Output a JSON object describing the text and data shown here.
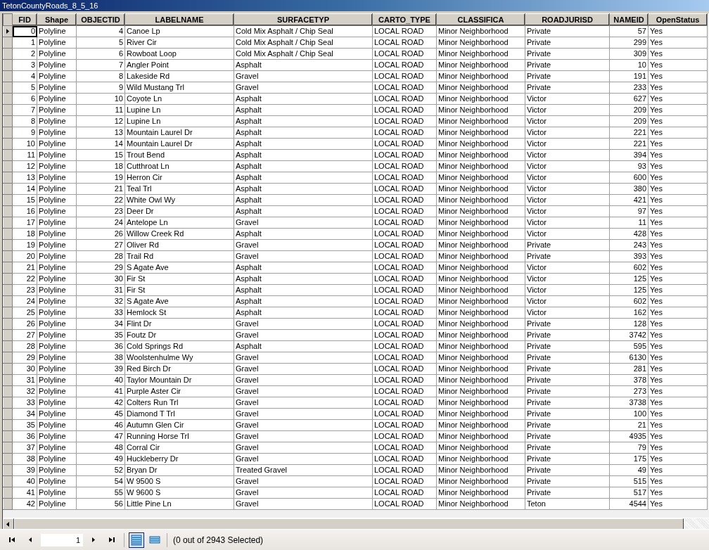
{
  "window": {
    "title": "TetonCountyRoads_8_5_16"
  },
  "table": {
    "columns": [
      {
        "label": "FID",
        "kind": "number"
      },
      {
        "label": "Shape",
        "kind": "text"
      },
      {
        "label": "OBJECTID",
        "kind": "number"
      },
      {
        "label": "LABELNAME",
        "kind": "text"
      },
      {
        "label": "SURFACETYP",
        "kind": "text"
      },
      {
        "label": "CARTO_TYPE",
        "kind": "text"
      },
      {
        "label": "CLASSIFICA",
        "kind": "text"
      },
      {
        "label": "ROADJURISD",
        "kind": "text"
      },
      {
        "label": "NAMEID",
        "kind": "number"
      },
      {
        "label": "OpenStatus",
        "kind": "text"
      }
    ],
    "rows": [
      {
        "current": true,
        "cells": [
          "0",
          "Polyline",
          "4",
          "Canoe Lp",
          "Cold Mix Asphalt / Chip Seal",
          "LOCAL ROAD",
          "Minor Neighborhood",
          "Private",
          "57",
          "Yes"
        ]
      },
      {
        "current": false,
        "cells": [
          "1",
          "Polyline",
          "5",
          "River Cir",
          "Cold Mix Asphalt / Chip Seal",
          "LOCAL ROAD",
          "Minor Neighborhood",
          "Private",
          "299",
          "Yes"
        ]
      },
      {
        "current": false,
        "cells": [
          "2",
          "Polyline",
          "6",
          "Rowboat Loop",
          "Cold Mix Asphalt / Chip Seal",
          "LOCAL ROAD",
          "Minor Neighborhood",
          "Private",
          "309",
          "Yes"
        ]
      },
      {
        "current": false,
        "cells": [
          "3",
          "Polyline",
          "7",
          "Angler Point",
          "Asphalt",
          "LOCAL ROAD",
          "Minor Neighborhood",
          "Private",
          "10",
          "Yes"
        ]
      },
      {
        "current": false,
        "cells": [
          "4",
          "Polyline",
          "8",
          "Lakeside Rd",
          "Gravel",
          "LOCAL ROAD",
          "Minor Neighborhood",
          "Private",
          "191",
          "Yes"
        ]
      },
      {
        "current": false,
        "cells": [
          "5",
          "Polyline",
          "9",
          "Wild Mustang Trl",
          "Gravel",
          "LOCAL ROAD",
          "Minor Neighborhood",
          "Private",
          "233",
          "Yes"
        ]
      },
      {
        "current": false,
        "cells": [
          "6",
          "Polyline",
          "10",
          "Coyote Ln",
          "Asphalt",
          "LOCAL ROAD",
          "Minor Neighborhood",
          "Victor",
          "627",
          "Yes"
        ]
      },
      {
        "current": false,
        "cells": [
          "7",
          "Polyline",
          "11",
          "Lupine Ln",
          "Asphalt",
          "LOCAL ROAD",
          "Minor Neighborhood",
          "Victor",
          "209",
          "Yes"
        ]
      },
      {
        "current": false,
        "cells": [
          "8",
          "Polyline",
          "12",
          "Lupine Ln",
          "Asphalt",
          "LOCAL ROAD",
          "Minor Neighborhood",
          "Victor",
          "209",
          "Yes"
        ]
      },
      {
        "current": false,
        "cells": [
          "9",
          "Polyline",
          "13",
          "Mountain Laurel Dr",
          "Asphalt",
          "LOCAL ROAD",
          "Minor Neighborhood",
          "Victor",
          "221",
          "Yes"
        ]
      },
      {
        "current": false,
        "cells": [
          "10",
          "Polyline",
          "14",
          "Mountain Laurel Dr",
          "Asphalt",
          "LOCAL ROAD",
          "Minor Neighborhood",
          "Victor",
          "221",
          "Yes"
        ]
      },
      {
        "current": false,
        "cells": [
          "11",
          "Polyline",
          "15",
          "Trout Bend",
          "Asphalt",
          "LOCAL ROAD",
          "Minor Neighborhood",
          "Victor",
          "394",
          "Yes"
        ]
      },
      {
        "current": false,
        "cells": [
          "12",
          "Polyline",
          "18",
          "Cutthroat Ln",
          "Asphalt",
          "LOCAL ROAD",
          "Minor Neighborhood",
          "Victor",
          "93",
          "Yes"
        ]
      },
      {
        "current": false,
        "cells": [
          "13",
          "Polyline",
          "19",
          "Herron Cir",
          "Asphalt",
          "LOCAL ROAD",
          "Minor Neighborhood",
          "Victor",
          "600",
          "Yes"
        ]
      },
      {
        "current": false,
        "cells": [
          "14",
          "Polyline",
          "21",
          "Teal Trl",
          "Asphalt",
          "LOCAL ROAD",
          "Minor Neighborhood",
          "Victor",
          "380",
          "Yes"
        ]
      },
      {
        "current": false,
        "cells": [
          "15",
          "Polyline",
          "22",
          "White Owl Wy",
          "Asphalt",
          "LOCAL ROAD",
          "Minor Neighborhood",
          "Victor",
          "421",
          "Yes"
        ]
      },
      {
        "current": false,
        "cells": [
          "16",
          "Polyline",
          "23",
          "Deer Dr",
          "Asphalt",
          "LOCAL ROAD",
          "Minor Neighborhood",
          "Victor",
          "97",
          "Yes"
        ]
      },
      {
        "current": false,
        "cells": [
          "17",
          "Polyline",
          "24",
          "Antelope Ln",
          "Gravel",
          "LOCAL ROAD",
          "Minor Neighborhood",
          "Victor",
          "11",
          "Yes"
        ]
      },
      {
        "current": false,
        "cells": [
          "18",
          "Polyline",
          "26",
          "Willow Creek Rd",
          "Asphalt",
          "LOCAL ROAD",
          "Minor Neighborhood",
          "Victor",
          "428",
          "Yes"
        ]
      },
      {
        "current": false,
        "cells": [
          "19",
          "Polyline",
          "27",
          "Oliver Rd",
          "Gravel",
          "LOCAL ROAD",
          "Minor Neighborhood",
          "Private",
          "243",
          "Yes"
        ]
      },
      {
        "current": false,
        "cells": [
          "20",
          "Polyline",
          "28",
          "Trail Rd",
          "Gravel",
          "LOCAL ROAD",
          "Minor Neighborhood",
          "Private",
          "393",
          "Yes"
        ]
      },
      {
        "current": false,
        "cells": [
          "21",
          "Polyline",
          "29",
          "S Agate Ave",
          "Asphalt",
          "LOCAL ROAD",
          "Minor Neighborhood",
          "Victor",
          "602",
          "Yes"
        ]
      },
      {
        "current": false,
        "cells": [
          "22",
          "Polyline",
          "30",
          "Fir St",
          "Asphalt",
          "LOCAL ROAD",
          "Minor Neighborhood",
          "Victor",
          "125",
          "Yes"
        ]
      },
      {
        "current": false,
        "cells": [
          "23",
          "Polyline",
          "31",
          "Fir St",
          "Asphalt",
          "LOCAL ROAD",
          "Minor Neighborhood",
          "Victor",
          "125",
          "Yes"
        ]
      },
      {
        "current": false,
        "cells": [
          "24",
          "Polyline",
          "32",
          "S Agate Ave",
          "Asphalt",
          "LOCAL ROAD",
          "Minor Neighborhood",
          "Victor",
          "602",
          "Yes"
        ]
      },
      {
        "current": false,
        "cells": [
          "25",
          "Polyline",
          "33",
          "Hemlock St",
          "Asphalt",
          "LOCAL ROAD",
          "Minor Neighborhood",
          "Victor",
          "162",
          "Yes"
        ]
      },
      {
        "current": false,
        "cells": [
          "26",
          "Polyline",
          "34",
          "Flint Dr",
          "Gravel",
          "LOCAL ROAD",
          "Minor Neighborhood",
          "Private",
          "128",
          "Yes"
        ]
      },
      {
        "current": false,
        "cells": [
          "27",
          "Polyline",
          "35",
          "Foutz Dr",
          "Gravel",
          "LOCAL ROAD",
          "Minor Neighborhood",
          "Private",
          "3742",
          "Yes"
        ]
      },
      {
        "current": false,
        "cells": [
          "28",
          "Polyline",
          "36",
          "Cold Springs Rd",
          "Asphalt",
          "LOCAL ROAD",
          "Minor Neighborhood",
          "Private",
          "595",
          "Yes"
        ]
      },
      {
        "current": false,
        "cells": [
          "29",
          "Polyline",
          "38",
          "Woolstenhulme Wy",
          "Gravel",
          "LOCAL ROAD",
          "Minor Neighborhood",
          "Private",
          "6130",
          "Yes"
        ]
      },
      {
        "current": false,
        "cells": [
          "30",
          "Polyline",
          "39",
          "Red Birch Dr",
          "Gravel",
          "LOCAL ROAD",
          "Minor Neighborhood",
          "Private",
          "281",
          "Yes"
        ]
      },
      {
        "current": false,
        "cells": [
          "31",
          "Polyline",
          "40",
          "Taylor Mountain Dr",
          "Gravel",
          "LOCAL ROAD",
          "Minor Neighborhood",
          "Private",
          "378",
          "Yes"
        ]
      },
      {
        "current": false,
        "cells": [
          "32",
          "Polyline",
          "41",
          "Purple Aster Cir",
          "Gravel",
          "LOCAL ROAD",
          "Minor Neighborhood",
          "Private",
          "273",
          "Yes"
        ]
      },
      {
        "current": false,
        "cells": [
          "33",
          "Polyline",
          "42",
          "Colters Run Trl",
          "Gravel",
          "LOCAL ROAD",
          "Minor Neighborhood",
          "Private",
          "3738",
          "Yes"
        ]
      },
      {
        "current": false,
        "cells": [
          "34",
          "Polyline",
          "45",
          "Diamond T Trl",
          "Gravel",
          "LOCAL ROAD",
          "Minor Neighborhood",
          "Private",
          "100",
          "Yes"
        ]
      },
      {
        "current": false,
        "cells": [
          "35",
          "Polyline",
          "46",
          "Autumn Glen Cir",
          "Gravel",
          "LOCAL ROAD",
          "Minor Neighborhood",
          "Private",
          "21",
          "Yes"
        ]
      },
      {
        "current": false,
        "cells": [
          "36",
          "Polyline",
          "47",
          "Running Horse Trl",
          "Gravel",
          "LOCAL ROAD",
          "Minor Neighborhood",
          "Private",
          "4935",
          "Yes"
        ]
      },
      {
        "current": false,
        "cells": [
          "37",
          "Polyline",
          "48",
          "Corral Cir",
          "Gravel",
          "LOCAL ROAD",
          "Minor Neighborhood",
          "Private",
          "79",
          "Yes"
        ]
      },
      {
        "current": false,
        "cells": [
          "38",
          "Polyline",
          "49",
          "Huckleberry Dr",
          "Gravel",
          "LOCAL ROAD",
          "Minor Neighborhood",
          "Private",
          "175",
          "Yes"
        ]
      },
      {
        "current": false,
        "cells": [
          "39",
          "Polyline",
          "52",
          "Bryan Dr",
          "Treated Gravel",
          "LOCAL ROAD",
          "Minor Neighborhood",
          "Private",
          "49",
          "Yes"
        ]
      },
      {
        "current": false,
        "cells": [
          "40",
          "Polyline",
          "54",
          "W 9500 S",
          "Gravel",
          "LOCAL ROAD",
          "Minor Neighborhood",
          "Private",
          "515",
          "Yes"
        ]
      },
      {
        "current": false,
        "cells": [
          "41",
          "Polyline",
          "55",
          "W 9600 S",
          "Gravel",
          "LOCAL ROAD",
          "Minor Neighborhood",
          "Private",
          "517",
          "Yes"
        ]
      },
      {
        "current": false,
        "cells": [
          "42",
          "Polyline",
          "56",
          "Little Pine Ln",
          "Gravel",
          "LOCAL ROAD",
          "Minor Neighborhood",
          "Teton",
          "4544",
          "Yes"
        ]
      }
    ]
  },
  "toolbar": {
    "record": "1",
    "views": [
      {
        "kind": "all_records",
        "selected": true
      },
      {
        "kind": "selected_records",
        "selected": false
      }
    ],
    "status": "(0 out of 2943 Selected)"
  }
}
